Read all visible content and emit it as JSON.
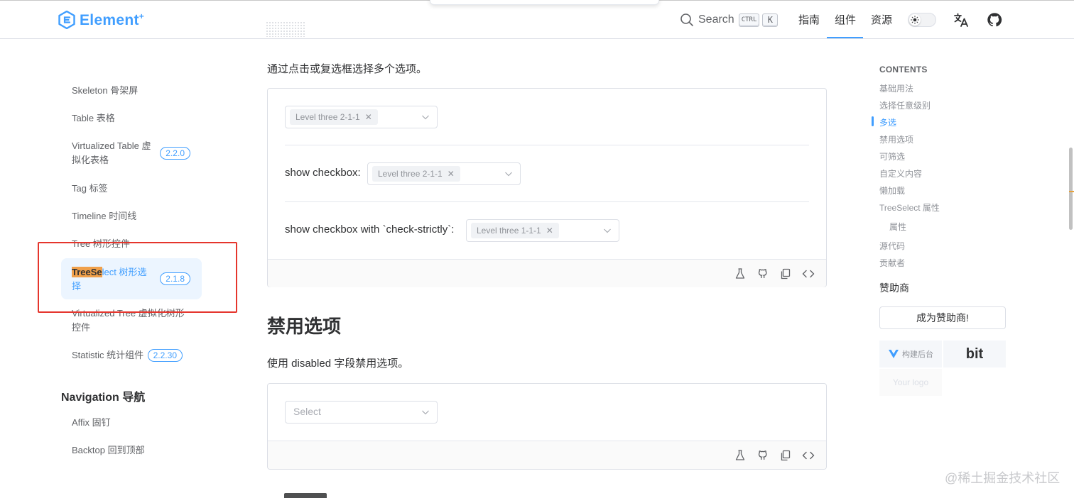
{
  "header": {
    "logo_text": "Element",
    "logo_sup": "+",
    "search_label": "Search",
    "kbd_ctrl": "CTRL",
    "kbd_k": "K",
    "nav": [
      "指南",
      "组件",
      "资源"
    ],
    "active_nav": "组件",
    "icons": [
      "search-icon",
      "sun-icon",
      "translate-icon",
      "github-icon"
    ]
  },
  "sidebar": {
    "items": [
      {
        "label": "Skeleton 骨架屏",
        "badge": ""
      },
      {
        "label": "Table 表格",
        "badge": ""
      },
      {
        "label": "Virtualized Table 虚拟化表格",
        "badge": "2.2.0"
      },
      {
        "label": "Tag 标签",
        "badge": ""
      },
      {
        "label": "Timeline 时间线",
        "badge": ""
      },
      {
        "label": "Tree 树形控件",
        "badge": ""
      },
      {
        "label_highlight": "TreeSe",
        "label_rest": "lect 树形选择",
        "badge": "2.1.8",
        "active": true
      },
      {
        "label": "Virtualized Tree 虚拟化树形控件",
        "badge": ""
      },
      {
        "label": "Statistic 统计组件",
        "badge": "2.2.30"
      }
    ],
    "group_title": "Navigation 导航",
    "group_items": [
      "Affix 固钉",
      "Backtop 回到顶部"
    ]
  },
  "main": {
    "intro": "通过点击或复选框选择多个选项。",
    "demo1": {
      "select1_tag": "Level three 2-1-1",
      "row2_label": "show checkbox:",
      "select2_tag": "Level three 2-1-1",
      "row3_label": "show checkbox with `check-strictly`:",
      "select3_tag": "Level three 1-1-1"
    },
    "footer_icons": [
      "playground-icon",
      "github-icon",
      "copy-icon",
      "code-icon"
    ],
    "section_title": "禁用选项",
    "section_desc": "使用 disabled 字段禁用选项。",
    "demo2": {
      "placeholder": "Select"
    }
  },
  "toc": {
    "title": "CONTENTS",
    "items": [
      "基础用法",
      "选择任意级别",
      "多选",
      "禁用选项",
      "可筛选",
      "自定义内容",
      "懒加载",
      "TreeSelect 属性",
      "属性",
      "源代码",
      "贡献者"
    ],
    "active": "多选"
  },
  "sponsor": {
    "heading": "赞助商",
    "button": "成为赞助商!",
    "tile1": "构建后台",
    "tile2": "bit",
    "tile3": "Your logo"
  },
  "watermark": "@稀土掘金技术社区",
  "colors": {
    "primary": "#409eff",
    "highlight": "#f0a04b",
    "annotation_red": "#e5352c"
  }
}
